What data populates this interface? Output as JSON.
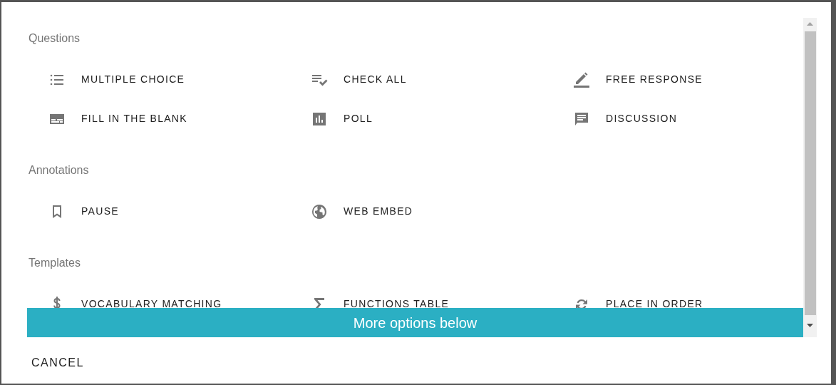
{
  "sections": [
    {
      "title": "Questions",
      "items": [
        {
          "label": "MULTIPLE CHOICE"
        },
        {
          "label": "CHECK ALL"
        },
        {
          "label": "FREE RESPONSE"
        },
        {
          "label": "FILL IN THE BLANK"
        },
        {
          "label": "POLL"
        },
        {
          "label": "DISCUSSION"
        }
      ]
    },
    {
      "title": "Annotations",
      "items": [
        {
          "label": "PAUSE"
        },
        {
          "label": "WEB EMBED"
        }
      ]
    },
    {
      "title": "Templates",
      "items": [
        {
          "label": "VOCABULARY MATCHING"
        },
        {
          "label": "FUNCTIONS TABLE"
        },
        {
          "label": "PLACE IN ORDER"
        }
      ]
    }
  ],
  "banner": "More options below",
  "cancel_button": "CANCEL"
}
